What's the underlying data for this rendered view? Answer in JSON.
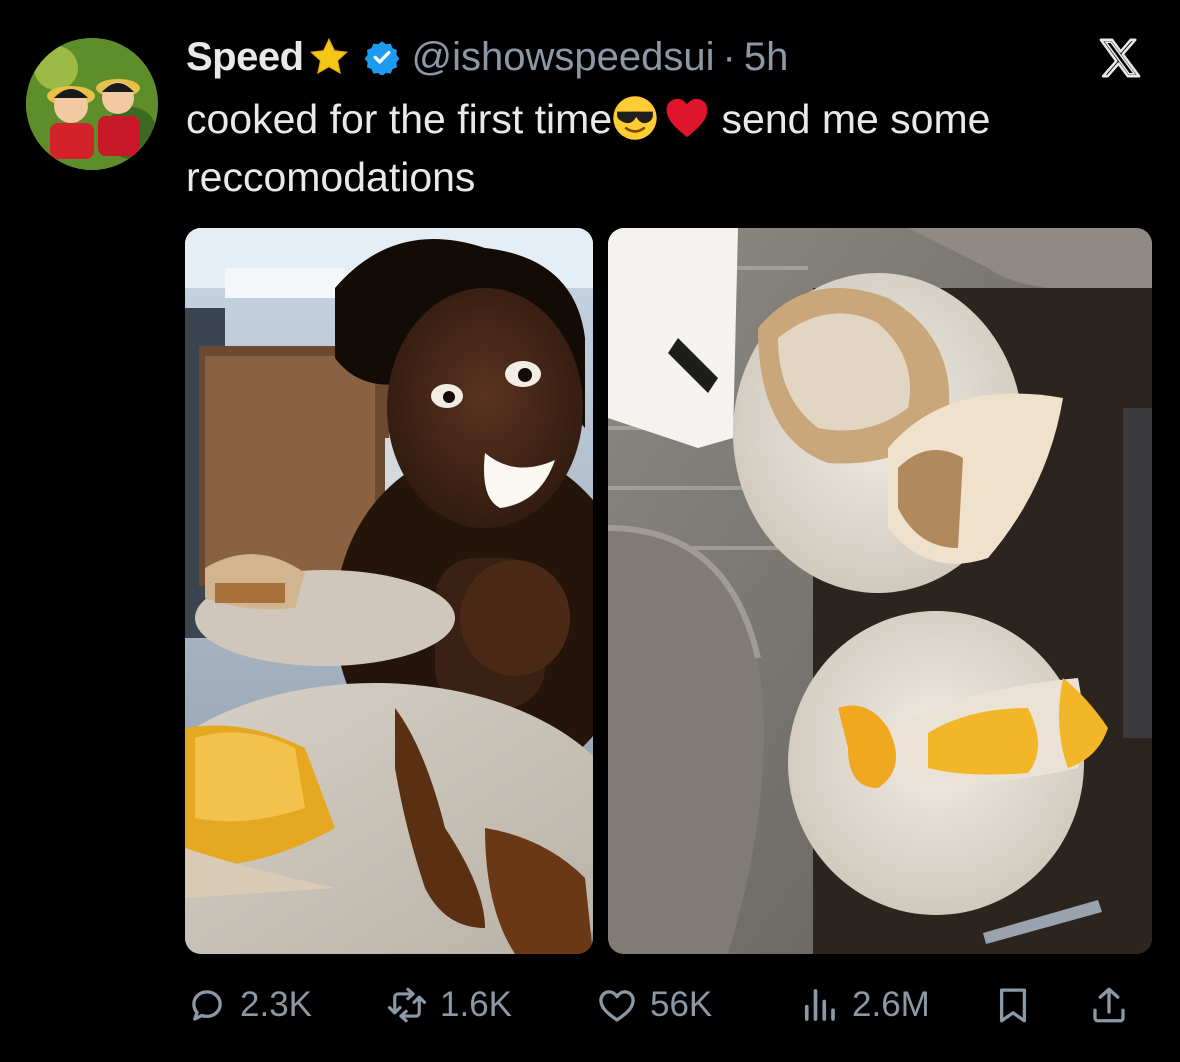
{
  "tweet": {
    "display_name": "Speed",
    "handle": "@ishowspeedsui",
    "separator": "·",
    "timestamp": "5h",
    "text_part1": "cooked for the first time",
    "text_part2": " send me some reccomodations",
    "badges": [
      "star-emoji",
      "verified-badge"
    ],
    "emojis": [
      "sunglasses-emoji",
      "red-heart-emoji"
    ]
  },
  "stats": {
    "replies": "2.3K",
    "reposts": "1.6K",
    "likes": "56K",
    "views": "2.6M"
  },
  "media": [
    {
      "description_icon": "photo-selfie-with-food"
    },
    {
      "description_icon": "photo-plates-of-food"
    }
  ],
  "colors": {
    "background": "#000000",
    "text": "#e7e9ea",
    "secondary": "#8b98a5",
    "verified": "#1d9bf0",
    "star": "#f5c518",
    "heart": "#e0142b"
  }
}
